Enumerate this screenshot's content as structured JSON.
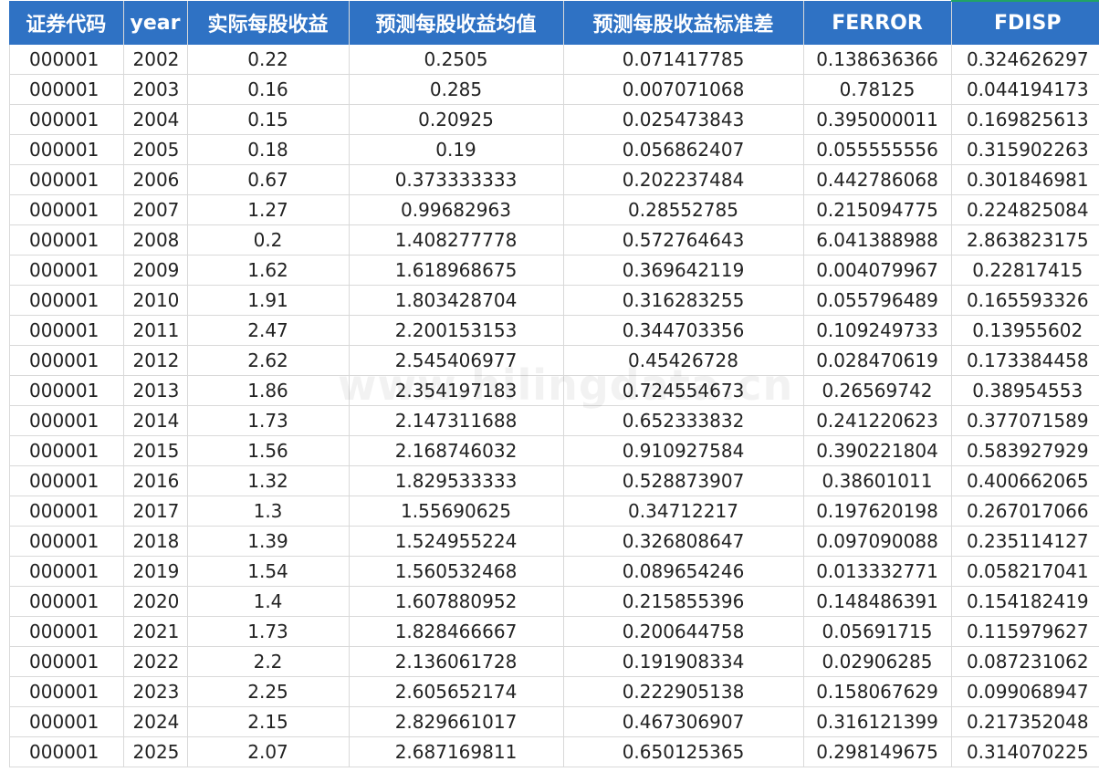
{
  "table": {
    "headers": [
      "证券代码",
      "year",
      "实际每股收益",
      "预测每股收益均值",
      "预测每股收益标准差",
      "FERROR",
      "FDISP"
    ],
    "rows": [
      [
        "000001",
        "2002",
        "0.22",
        "0.2505",
        "0.071417785",
        "0.138636366",
        "0.324626297"
      ],
      [
        "000001",
        "2003",
        "0.16",
        "0.285",
        "0.007071068",
        "0.78125",
        "0.044194173"
      ],
      [
        "000001",
        "2004",
        "0.15",
        "0.20925",
        "0.025473843",
        "0.395000011",
        "0.169825613"
      ],
      [
        "000001",
        "2005",
        "0.18",
        "0.19",
        "0.056862407",
        "0.055555556",
        "0.315902263"
      ],
      [
        "000001",
        "2006",
        "0.67",
        "0.373333333",
        "0.202237484",
        "0.442786068",
        "0.301846981"
      ],
      [
        "000001",
        "2007",
        "1.27",
        "0.99682963",
        "0.28552785",
        "0.215094775",
        "0.224825084"
      ],
      [
        "000001",
        "2008",
        "0.2",
        "1.408277778",
        "0.572764643",
        "6.041388988",
        "2.863823175"
      ],
      [
        "000001",
        "2009",
        "1.62",
        "1.618968675",
        "0.369642119",
        "0.004079967",
        "0.22817415"
      ],
      [
        "000001",
        "2010",
        "1.91",
        "1.803428704",
        "0.316283255",
        "0.055796489",
        "0.165593326"
      ],
      [
        "000001",
        "2011",
        "2.47",
        "2.200153153",
        "0.344703356",
        "0.109249733",
        "0.13955602"
      ],
      [
        "000001",
        "2012",
        "2.62",
        "2.545406977",
        "0.45426728",
        "0.028470619",
        "0.173384458"
      ],
      [
        "000001",
        "2013",
        "1.86",
        "2.354197183",
        "0.724554673",
        "0.26569742",
        "0.38954553"
      ],
      [
        "000001",
        "2014",
        "1.73",
        "2.147311688",
        "0.652333832",
        "0.241220623",
        "0.377071589"
      ],
      [
        "000001",
        "2015",
        "1.56",
        "2.168746032",
        "0.910927584",
        "0.390221804",
        "0.583927929"
      ],
      [
        "000001",
        "2016",
        "1.32",
        "1.829533333",
        "0.528873907",
        "0.38601011",
        "0.400662065"
      ],
      [
        "000001",
        "2017",
        "1.3",
        "1.55690625",
        "0.34712217",
        "0.197620198",
        "0.267017066"
      ],
      [
        "000001",
        "2018",
        "1.39",
        "1.524955224",
        "0.326808647",
        "0.097090088",
        "0.235114127"
      ],
      [
        "000001",
        "2019",
        "1.54",
        "1.560532468",
        "0.089654246",
        "0.013332771",
        "0.058217041"
      ],
      [
        "000001",
        "2020",
        "1.4",
        "1.607880952",
        "0.215855396",
        "0.148486391",
        "0.154182419"
      ],
      [
        "000001",
        "2021",
        "1.73",
        "1.828466667",
        "0.200644758",
        "0.05691715",
        "0.115979627"
      ],
      [
        "000001",
        "2022",
        "2.2",
        "2.136061728",
        "0.191908334",
        "0.02906285",
        "0.087231062"
      ],
      [
        "000001",
        "2023",
        "2.25",
        "2.605652174",
        "0.222905138",
        "0.158067629",
        "0.099068947"
      ],
      [
        "000001",
        "2024",
        "2.15",
        "2.829661017",
        "0.467306907",
        "0.316121399",
        "0.217352048"
      ],
      [
        "000001",
        "2025",
        "2.07",
        "2.687169811",
        "0.650125365",
        "0.298149675",
        "0.314070225"
      ]
    ]
  },
  "watermark": "www.hilingdata.cn",
  "colors": {
    "header_bg": "#2f72c4",
    "header_text": "#ffffff",
    "grid": "#d9d9d9",
    "accent": "#21a366"
  }
}
